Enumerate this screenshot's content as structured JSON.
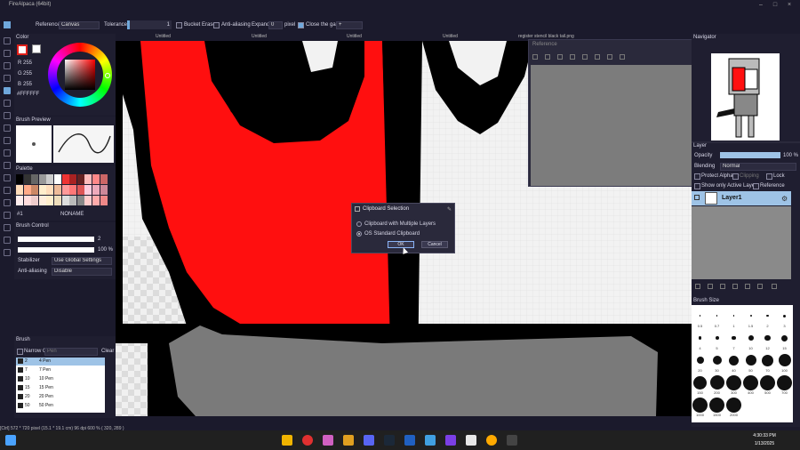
{
  "app": {
    "title": "FireAlpaca (64bit)"
  },
  "tool_options": {
    "reference_label": "Reference",
    "reference_value": "Canvas",
    "tolerance_label": "Tolerance",
    "tolerance_value": "1",
    "bucket_erase_label": "Bucket Erase",
    "anti_aliasing_label": "Anti-aliasing",
    "expand_label": "Expand",
    "expand_value": "0",
    "expand_unit": "pixel",
    "close_gap_label": "Close the gap",
    "close_gap_value": "+"
  },
  "tabs": [
    "Untitled",
    "Untitled",
    "Untitled",
    "Untitled",
    "register stencil black tail.png"
  ],
  "color_panel": {
    "title": "Color",
    "r_label": "R",
    "r_value": "255",
    "g_label": "G",
    "g_value": "255",
    "b_label": "B",
    "b_value": "255",
    "hex": "#FFFFFF"
  },
  "brush_preview": {
    "title": "Brush Preview"
  },
  "palette": {
    "title": "Palette",
    "index": "#1",
    "name": "NONAME"
  },
  "brush_control": {
    "title": "Brush Control",
    "size_value": "2",
    "opacity_value": "100 %",
    "stabilizer_label": "Stabilizer",
    "stabilizer_value": "Use Global Settings",
    "antialias_label": "Anti-aliasing",
    "antialias_value": "Disable"
  },
  "brush_list": {
    "title": "Brush",
    "filter_label": "Narrow C",
    "filter_placeholder": "Pen",
    "clear_label": "Clear",
    "items": [
      {
        "num": "2",
        "name": "4 Pen"
      },
      {
        "num": "7",
        "name": "7 Pen"
      },
      {
        "num": "10",
        "name": "10 Pen"
      },
      {
        "num": "15",
        "name": "15 Pen"
      },
      {
        "num": "20",
        "name": "20 Pen"
      },
      {
        "num": "50",
        "name": "50 Pen"
      }
    ]
  },
  "reference_window": {
    "title": "Reference"
  },
  "dialog": {
    "title": "Clipboard Selection",
    "option1": "Clipboard with Multiple Layers",
    "option2": "OS Standard Clipboard",
    "ok_label": "OK",
    "cancel_label": "Cancel"
  },
  "navigator": {
    "title": "Navigator"
  },
  "layer_panel": {
    "title": "Layer",
    "opacity_label": "Opacity",
    "opacity_value": "100 %",
    "blending_label": "Blending",
    "blending_value": "Normal",
    "protect_alpha": "Protect Alpha",
    "clipping": "Clipping",
    "lock": "Lock",
    "show_only_active": "Show only Active Layer",
    "reference": "Reference",
    "layer_name": "Layer1"
  },
  "brush_size": {
    "title": "Brush Size",
    "sizes": [
      "0.5",
      "0.7",
      "1",
      "1.5",
      "2",
      "3",
      "4",
      "5",
      "7",
      "10",
      "12",
      "15",
      "20",
      "30",
      "40",
      "50",
      "70",
      "100",
      "150",
      "200",
      "300",
      "400",
      "500",
      "700",
      "1000",
      "1500",
      "2000"
    ]
  },
  "status": {
    "text": "[Ctrl]  572 * 720 pixel  (15.1 * 19.1 cm)  96 dpi  600 %  ( 320, 289 )"
  },
  "taskbar": {
    "time": "4:30:33 PM",
    "date": "1/13/2025"
  }
}
